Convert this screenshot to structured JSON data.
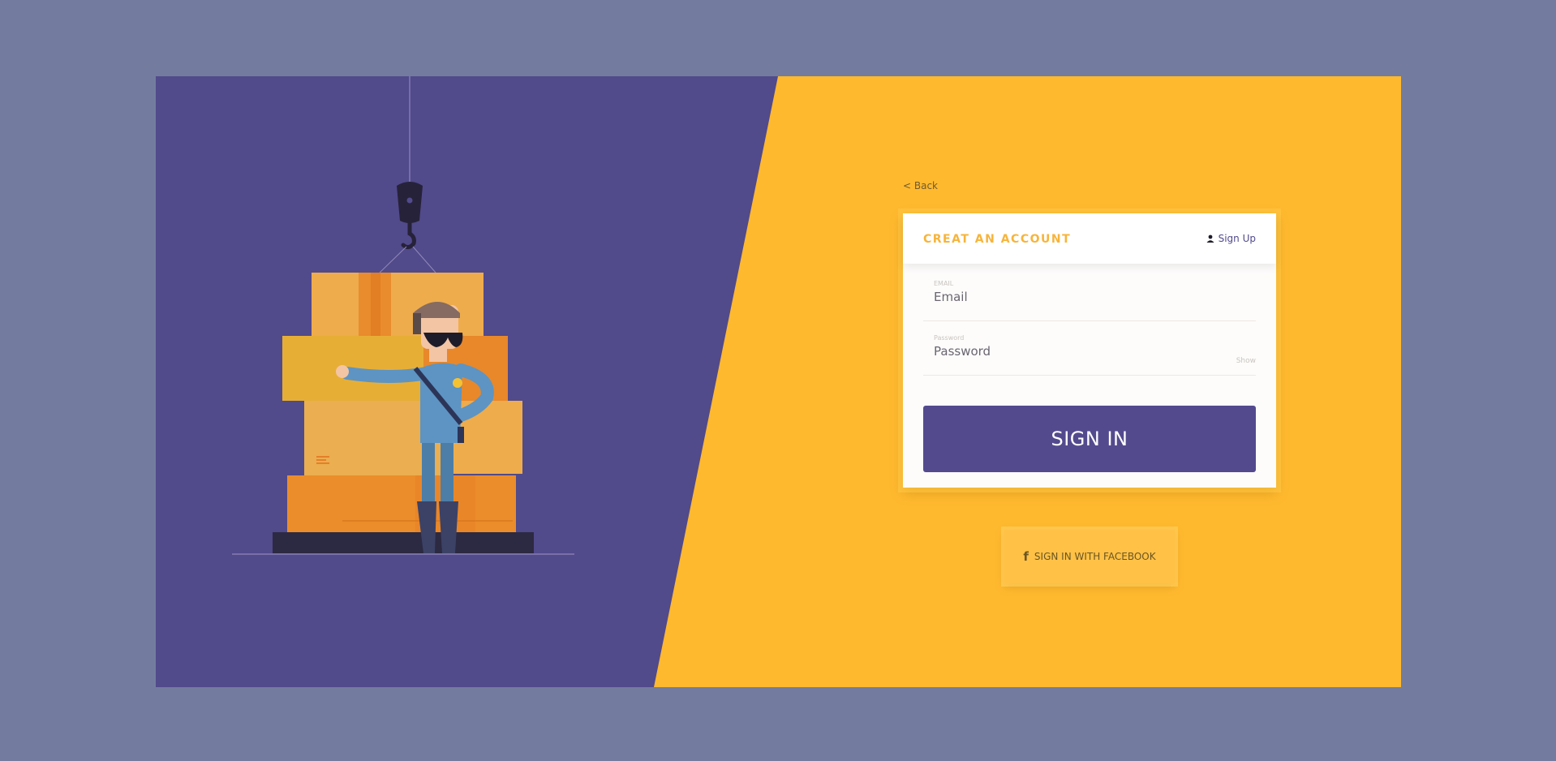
{
  "page": {
    "back_label": "< Back",
    "colors": {
      "background": "#737c9e",
      "left_panel": "#514a8b",
      "right_panel": "#ffb92f",
      "accent": "#f7b43a",
      "primary_button": "#534a8e"
    }
  },
  "card": {
    "title": "CREAT AN ACCOUNT",
    "signup_icon": "user-icon",
    "signup_label": "Sign Up",
    "email": {
      "caption": "EMAIL",
      "placeholder": "Email",
      "value": ""
    },
    "password": {
      "caption": "Password",
      "placeholder": "Password",
      "value": "",
      "toggle_label": "Show"
    },
    "signin_label": "SIGN IN"
  },
  "facebook": {
    "icon": "facebook-icon",
    "label": "SIGN IN WITH FACEBOOK"
  }
}
